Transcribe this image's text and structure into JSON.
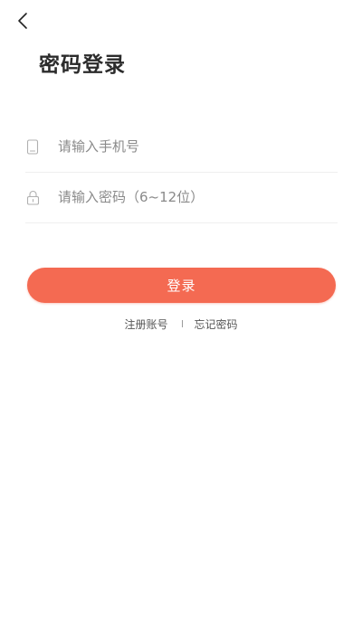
{
  "header": {
    "back_icon": "chevron-left-icon",
    "title": "密码登录"
  },
  "form": {
    "phone": {
      "icon": "phone-icon",
      "placeholder": "请输入手机号",
      "value": ""
    },
    "password": {
      "icon": "lock-icon",
      "placeholder": "请输入密码（6~12位）",
      "value": ""
    },
    "submit_label": "登录"
  },
  "links": {
    "register": "注册账号",
    "forgot": "忘记密码"
  },
  "colors": {
    "accent": "#f46a52",
    "title": "#2b2b2b",
    "placeholder": "#8a8a8a",
    "divider": "#efefef"
  }
}
